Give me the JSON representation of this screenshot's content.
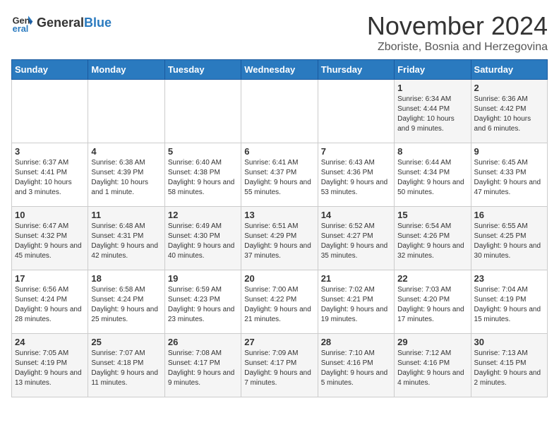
{
  "header": {
    "logo_general": "General",
    "logo_blue": "Blue",
    "month": "November 2024",
    "location": "Zboriste, Bosnia and Herzegovina"
  },
  "weekdays": [
    "Sunday",
    "Monday",
    "Tuesday",
    "Wednesday",
    "Thursday",
    "Friday",
    "Saturday"
  ],
  "weeks": [
    [
      {
        "day": "",
        "info": ""
      },
      {
        "day": "",
        "info": ""
      },
      {
        "day": "",
        "info": ""
      },
      {
        "day": "",
        "info": ""
      },
      {
        "day": "",
        "info": ""
      },
      {
        "day": "1",
        "info": "Sunrise: 6:34 AM\nSunset: 4:44 PM\nDaylight: 10 hours and 9 minutes."
      },
      {
        "day": "2",
        "info": "Sunrise: 6:36 AM\nSunset: 4:42 PM\nDaylight: 10 hours and 6 minutes."
      }
    ],
    [
      {
        "day": "3",
        "info": "Sunrise: 6:37 AM\nSunset: 4:41 PM\nDaylight: 10 hours and 3 minutes."
      },
      {
        "day": "4",
        "info": "Sunrise: 6:38 AM\nSunset: 4:39 PM\nDaylight: 10 hours and 1 minute."
      },
      {
        "day": "5",
        "info": "Sunrise: 6:40 AM\nSunset: 4:38 PM\nDaylight: 9 hours and 58 minutes."
      },
      {
        "day": "6",
        "info": "Sunrise: 6:41 AM\nSunset: 4:37 PM\nDaylight: 9 hours and 55 minutes."
      },
      {
        "day": "7",
        "info": "Sunrise: 6:43 AM\nSunset: 4:36 PM\nDaylight: 9 hours and 53 minutes."
      },
      {
        "day": "8",
        "info": "Sunrise: 6:44 AM\nSunset: 4:34 PM\nDaylight: 9 hours and 50 minutes."
      },
      {
        "day": "9",
        "info": "Sunrise: 6:45 AM\nSunset: 4:33 PM\nDaylight: 9 hours and 47 minutes."
      }
    ],
    [
      {
        "day": "10",
        "info": "Sunrise: 6:47 AM\nSunset: 4:32 PM\nDaylight: 9 hours and 45 minutes."
      },
      {
        "day": "11",
        "info": "Sunrise: 6:48 AM\nSunset: 4:31 PM\nDaylight: 9 hours and 42 minutes."
      },
      {
        "day": "12",
        "info": "Sunrise: 6:49 AM\nSunset: 4:30 PM\nDaylight: 9 hours and 40 minutes."
      },
      {
        "day": "13",
        "info": "Sunrise: 6:51 AM\nSunset: 4:29 PM\nDaylight: 9 hours and 37 minutes."
      },
      {
        "day": "14",
        "info": "Sunrise: 6:52 AM\nSunset: 4:27 PM\nDaylight: 9 hours and 35 minutes."
      },
      {
        "day": "15",
        "info": "Sunrise: 6:54 AM\nSunset: 4:26 PM\nDaylight: 9 hours and 32 minutes."
      },
      {
        "day": "16",
        "info": "Sunrise: 6:55 AM\nSunset: 4:25 PM\nDaylight: 9 hours and 30 minutes."
      }
    ],
    [
      {
        "day": "17",
        "info": "Sunrise: 6:56 AM\nSunset: 4:24 PM\nDaylight: 9 hours and 28 minutes."
      },
      {
        "day": "18",
        "info": "Sunrise: 6:58 AM\nSunset: 4:24 PM\nDaylight: 9 hours and 25 minutes."
      },
      {
        "day": "19",
        "info": "Sunrise: 6:59 AM\nSunset: 4:23 PM\nDaylight: 9 hours and 23 minutes."
      },
      {
        "day": "20",
        "info": "Sunrise: 7:00 AM\nSunset: 4:22 PM\nDaylight: 9 hours and 21 minutes."
      },
      {
        "day": "21",
        "info": "Sunrise: 7:02 AM\nSunset: 4:21 PM\nDaylight: 9 hours and 19 minutes."
      },
      {
        "day": "22",
        "info": "Sunrise: 7:03 AM\nSunset: 4:20 PM\nDaylight: 9 hours and 17 minutes."
      },
      {
        "day": "23",
        "info": "Sunrise: 7:04 AM\nSunset: 4:19 PM\nDaylight: 9 hours and 15 minutes."
      }
    ],
    [
      {
        "day": "24",
        "info": "Sunrise: 7:05 AM\nSunset: 4:19 PM\nDaylight: 9 hours and 13 minutes."
      },
      {
        "day": "25",
        "info": "Sunrise: 7:07 AM\nSunset: 4:18 PM\nDaylight: 9 hours and 11 minutes."
      },
      {
        "day": "26",
        "info": "Sunrise: 7:08 AM\nSunset: 4:17 PM\nDaylight: 9 hours and 9 minutes."
      },
      {
        "day": "27",
        "info": "Sunrise: 7:09 AM\nSunset: 4:17 PM\nDaylight: 9 hours and 7 minutes."
      },
      {
        "day": "28",
        "info": "Sunrise: 7:10 AM\nSunset: 4:16 PM\nDaylight: 9 hours and 5 minutes."
      },
      {
        "day": "29",
        "info": "Sunrise: 7:12 AM\nSunset: 4:16 PM\nDaylight: 9 hours and 4 minutes."
      },
      {
        "day": "30",
        "info": "Sunrise: 7:13 AM\nSunset: 4:15 PM\nDaylight: 9 hours and 2 minutes."
      }
    ]
  ]
}
